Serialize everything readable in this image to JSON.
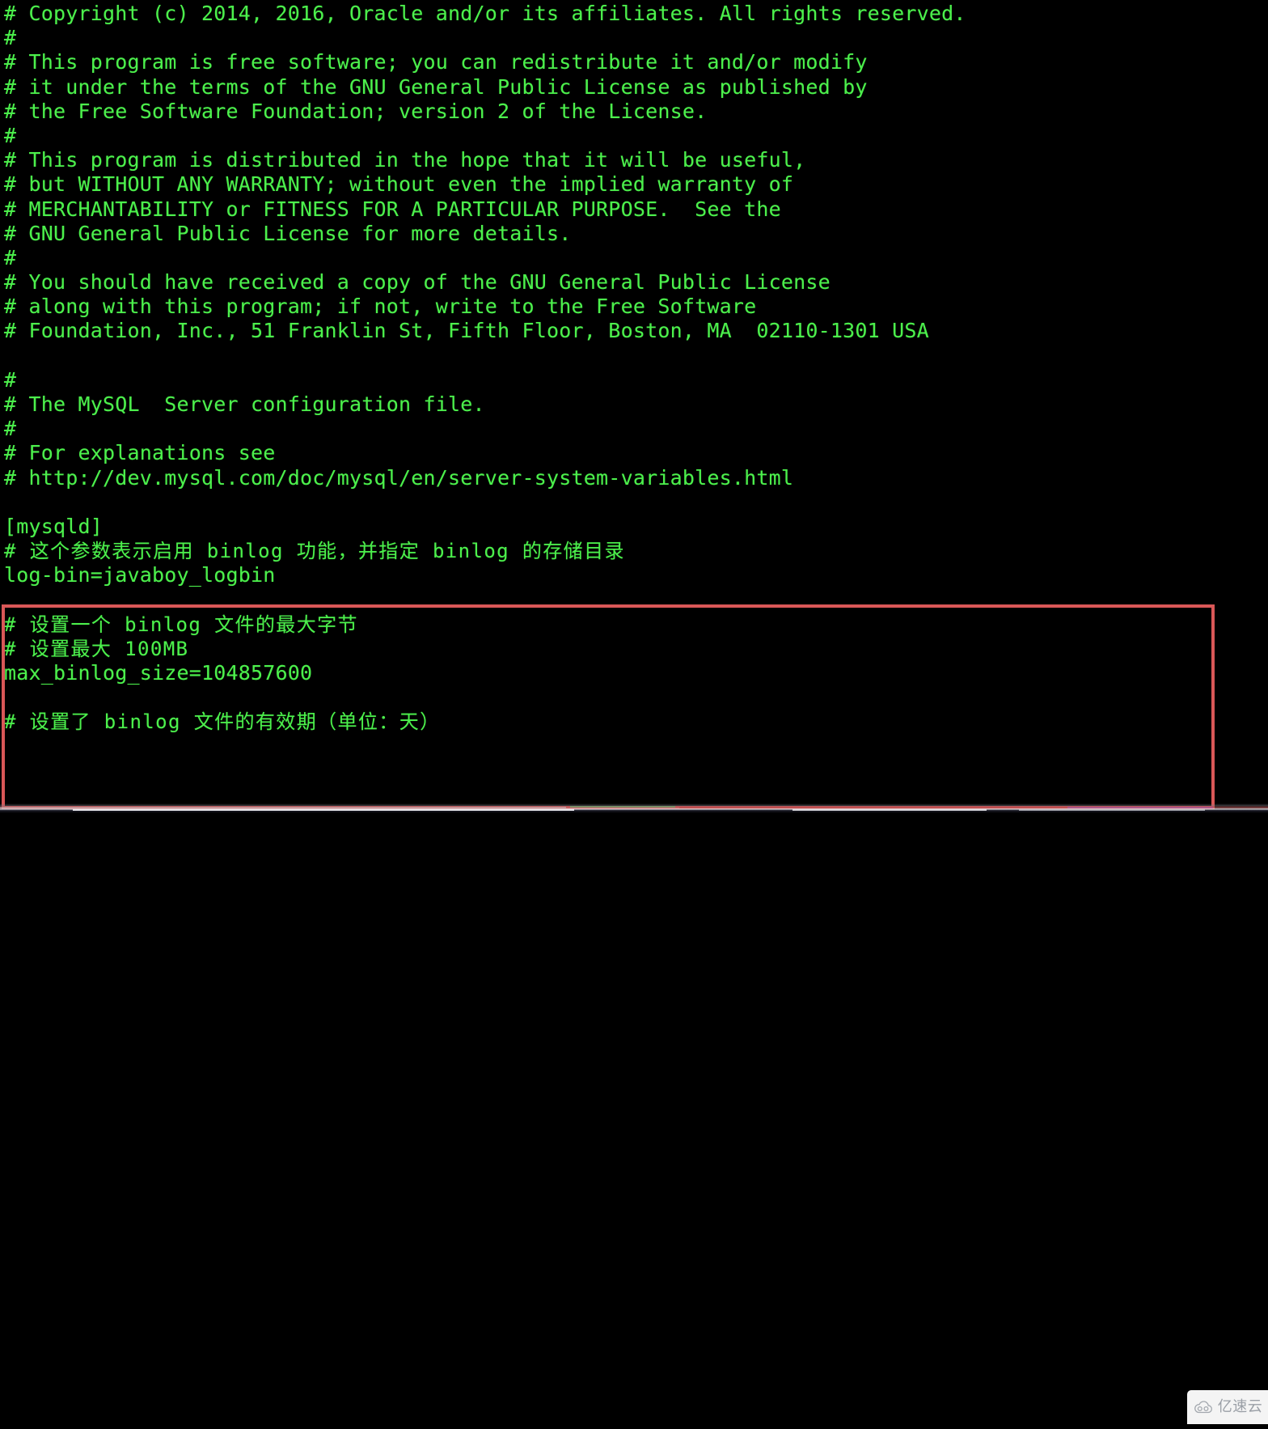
{
  "app": {
    "kind": "terminal-text-editor",
    "background_color": "#000000",
    "text_color": "#4cf04c",
    "file_kind": "MySQL my.cnf configuration file"
  },
  "terminal": {
    "lines": [
      {
        "text": "# Copyright (c) 2014, 2016, Oracle and/or its affiliates. All rights reserved.",
        "cjk": false
      },
      {
        "text": "#",
        "cjk": false
      },
      {
        "text": "# This program is free software; you can redistribute it and/or modify",
        "cjk": false
      },
      {
        "text": "# it under the terms of the GNU General Public License as published by",
        "cjk": false
      },
      {
        "text": "# the Free Software Foundation; version 2 of the License.",
        "cjk": false
      },
      {
        "text": "#",
        "cjk": false
      },
      {
        "text": "# This program is distributed in the hope that it will be useful,",
        "cjk": false
      },
      {
        "text": "# but WITHOUT ANY WARRANTY; without even the implied warranty of",
        "cjk": false
      },
      {
        "text": "# MERCHANTABILITY or FITNESS FOR A PARTICULAR PURPOSE.  See the",
        "cjk": false
      },
      {
        "text": "# GNU General Public License for more details.",
        "cjk": false
      },
      {
        "text": "#",
        "cjk": false
      },
      {
        "text": "# You should have received a copy of the GNU General Public License",
        "cjk": false
      },
      {
        "text": "# along with this program; if not, write to the Free Software",
        "cjk": false
      },
      {
        "text": "# Foundation, Inc., 51 Franklin St, Fifth Floor, Boston, MA  02110-1301 USA",
        "cjk": false
      },
      {
        "text": "",
        "cjk": false
      },
      {
        "text": "#",
        "cjk": false
      },
      {
        "text": "# The MySQL  Server configuration file.",
        "cjk": false
      },
      {
        "text": "#",
        "cjk": false
      },
      {
        "text": "# For explanations see",
        "cjk": false
      },
      {
        "text": "# http://dev.mysql.com/doc/mysql/en/server-system-variables.html",
        "cjk": false
      },
      {
        "text": "",
        "cjk": false
      },
      {
        "text": "[mysqld]",
        "cjk": false
      },
      {
        "text": "# 这个参数表示启用 binlog 功能，并指定 binlog 的存储目录",
        "cjk": true
      },
      {
        "text": "log-bin=javaboy_logbin",
        "cjk": false
      },
      {
        "text": "",
        "cjk": false
      },
      {
        "text": "# 设置一个 binlog 文件的最大字节",
        "cjk": true
      },
      {
        "text": "# 设置最大 100MB",
        "cjk": true
      },
      {
        "text": "max_binlog_size=104857600",
        "cjk": false
      },
      {
        "text": "",
        "cjk": false
      },
      {
        "text": "# 设置了 binlog 文件的有效期（单位：天）",
        "cjk": true
      }
    ]
  },
  "annotation": {
    "type": "rectangle-highlight",
    "color": "#d95757",
    "covers_from_line": "# 这个参数表示启用 binlog 功能，并指定 binlog 的存储目录",
    "covers_to_line": "max_binlog_size=104857600"
  },
  "watermark": {
    "text": "亿速云",
    "icon": "cloud-icon",
    "text_color": "#9a9fa6",
    "background_color": "#f4f4f4"
  }
}
